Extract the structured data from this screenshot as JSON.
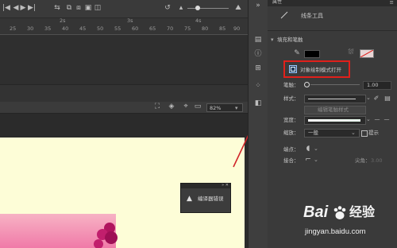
{
  "timeline": {
    "frame_labels": [
      "25",
      "30",
      "35",
      "40",
      "45",
      "50",
      "55",
      "60",
      "65",
      "70",
      "75",
      "80",
      "85",
      "90",
      "95"
    ],
    "second_labels": [
      "2s",
      "3s",
      "4s"
    ],
    "play_icons": [
      "|◀",
      "◀",
      "▶",
      "▶|"
    ]
  },
  "stage_toolbar": {
    "zoom": "82%",
    "zoom_arrow": "▾"
  },
  "floating_panel": {
    "title_buttons": "»  ✕",
    "warning_icon": "▲",
    "message": "编译器错误"
  },
  "properties": {
    "tab_label": "属性",
    "menu_icon": "≡",
    "tool_name": "线条工具",
    "fill_stroke_header": "填充和笔触",
    "object_draw_label": "对象绘制模式打开",
    "stroke_label": "笔触：",
    "stroke_value": "1.00",
    "style_label": "样式：",
    "style_button": "编辑笔触样式",
    "width_label": "宽度：",
    "scale_label": "缩放：",
    "scale_value": "一般",
    "hint_label": "提示",
    "cap_label": "端点：",
    "join_label": "接合：",
    "miter_label": "尖角：",
    "miter_value": "3.00",
    "colors": {
      "stroke_swatch": "#000000",
      "highlight_box": "#e0201b",
      "arrow": "#d0252a"
    }
  },
  "side_icons": [
    "layers-icon",
    "info-icon",
    "grid-icon",
    "swatches-icon",
    "components-icon"
  ],
  "watermark": {
    "brand": "Bai",
    "brand_suffix": "经验",
    "url": "jingyan.baidu.com"
  }
}
